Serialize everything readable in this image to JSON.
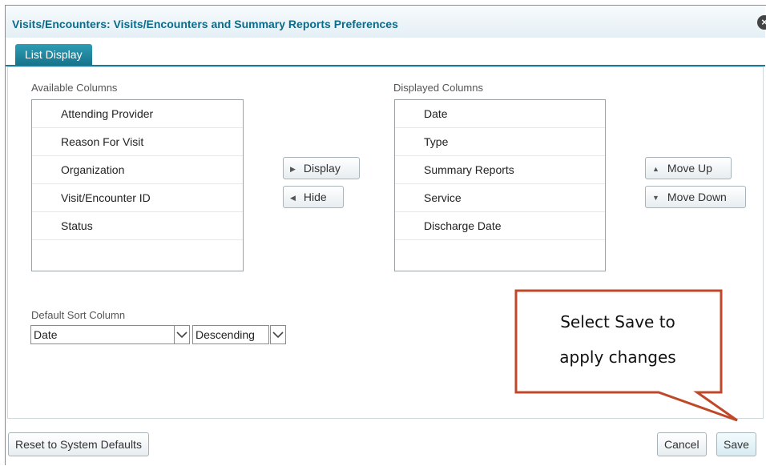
{
  "dialog": {
    "title": "Visits/Encounters: Visits/Encounters and Summary Reports Preferences",
    "close_glyph": "×"
  },
  "tabs": [
    {
      "label": "List Display"
    }
  ],
  "available": {
    "label": "Available Columns",
    "items": [
      "Attending Provider",
      "Reason For Visit",
      "Organization",
      "Visit/Encounter ID",
      "Status"
    ]
  },
  "displayed": {
    "label": "Displayed Columns",
    "items": [
      "Date",
      "Type",
      "Summary Reports",
      "Service",
      "Discharge Date"
    ]
  },
  "buttons": {
    "display": "Display",
    "hide": "Hide",
    "move_up": "Move Up",
    "move_down": "Move Down",
    "reset": "Reset to System Defaults",
    "cancel": "Cancel",
    "save": "Save"
  },
  "sort": {
    "label": "Default Sort Column",
    "column_value": "Date",
    "order_value": "Descending"
  },
  "callout": {
    "line1": "Select Save to",
    "line2": "apply changes",
    "color": "#c0482a"
  }
}
